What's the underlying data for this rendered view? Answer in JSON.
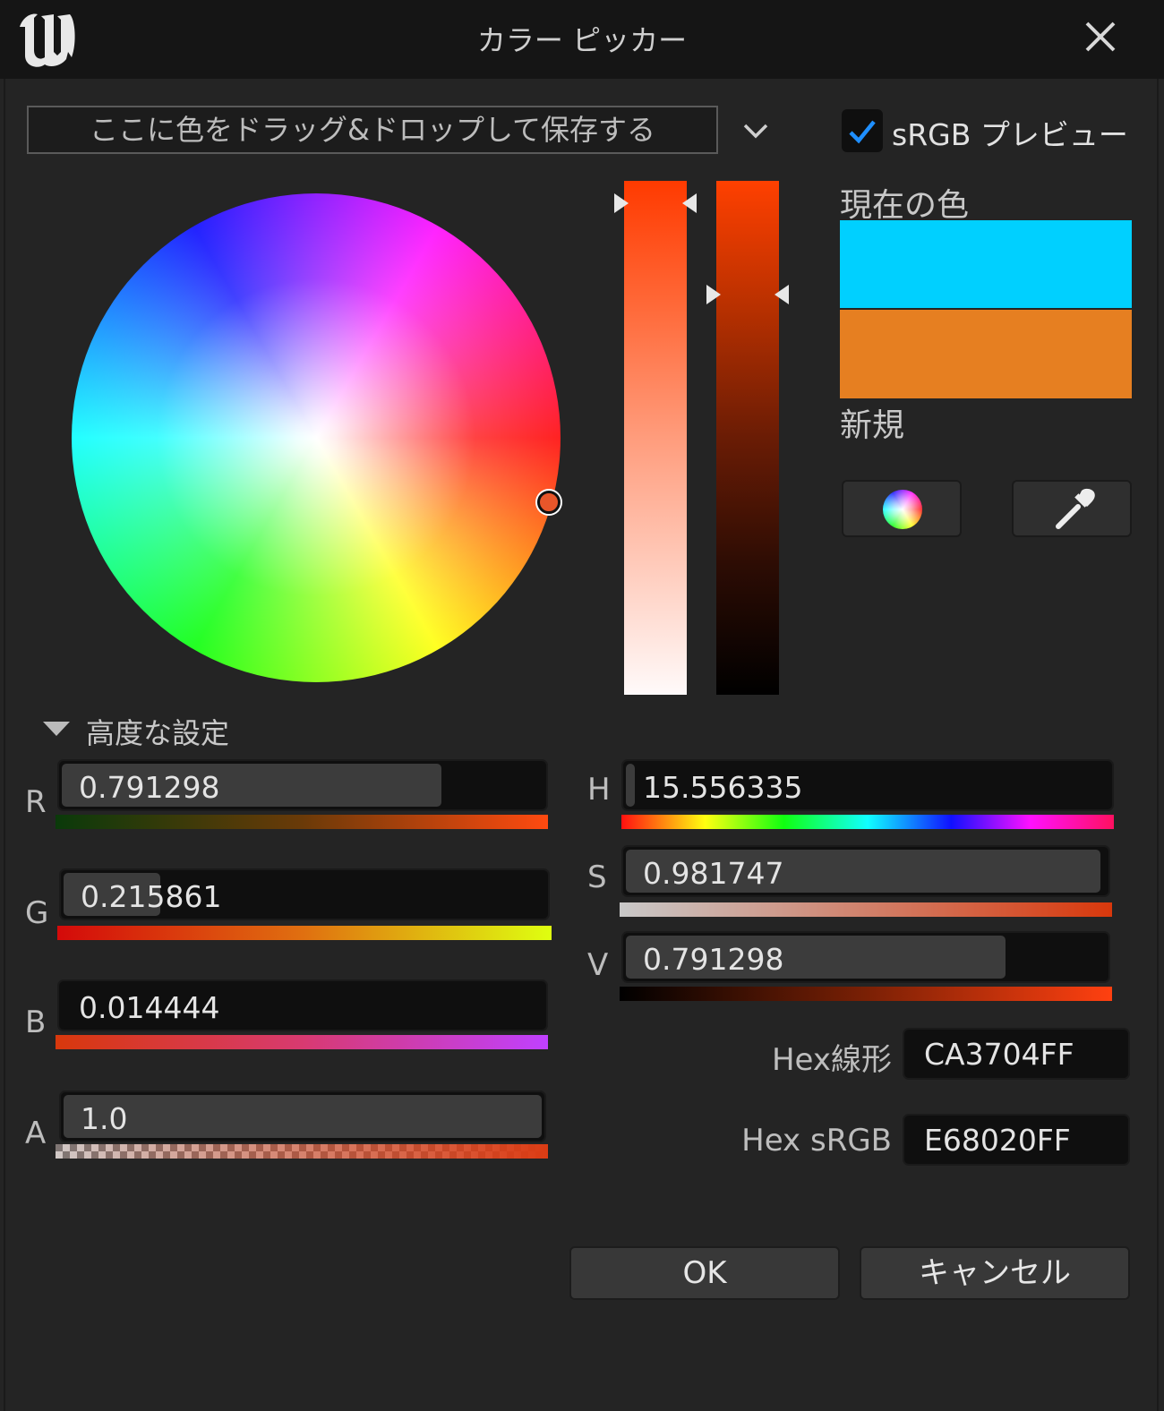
{
  "window": {
    "title": "カラー ピッカー"
  },
  "theme_bar": {
    "placeholder": "ここに色をドラッグ&ドロップして保存する"
  },
  "srgb_preview": {
    "label": "sRGB プレビュー",
    "checked": true
  },
  "colors": {
    "current": "#00d0ff",
    "new": "#e67f21"
  },
  "swatches": {
    "current_label": "現在の色",
    "new_label": "新規"
  },
  "advanced": {
    "label": "高度な設定",
    "expanded": true
  },
  "rgba": {
    "r": {
      "label": "R",
      "value": "0.791298"
    },
    "g": {
      "label": "G",
      "value": "0.215861"
    },
    "b": {
      "label": "B",
      "value": "0.014444"
    },
    "a": {
      "label": "A",
      "value": "1.0"
    }
  },
  "hsv": {
    "h": {
      "label": "H",
      "value": "15.556335"
    },
    "s": {
      "label": "S",
      "value": "0.981747"
    },
    "v": {
      "label": "V",
      "value": "0.791298"
    }
  },
  "hex": {
    "linear_label": "Hex線形",
    "linear_value": "CA3704FF",
    "srgb_label": "Hex sRGB",
    "srgb_value": "E68020FF"
  },
  "buttons": {
    "ok": "OK",
    "cancel": "キャンセル"
  }
}
